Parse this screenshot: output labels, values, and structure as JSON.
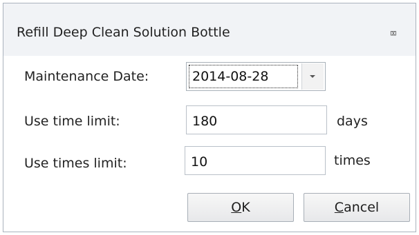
{
  "dialog": {
    "title": "Refill Deep Clean Solution Bottle",
    "close_glyph": "⌧"
  },
  "form": {
    "maintenance_date_label": "Maintenance Date:",
    "maintenance_date_value": "2014-08-28",
    "use_time_limit_label": "Use time limit:",
    "use_time_limit_value": "180",
    "use_time_limit_unit": "days",
    "use_times_limit_label": "Use times limit:",
    "use_times_limit_value": "10",
    "use_times_limit_unit": "times"
  },
  "buttons": {
    "ok_mnemonic": "O",
    "ok_rest": "K",
    "cancel_mnemonic": "C",
    "cancel_rest": "ancel"
  },
  "icons": {
    "close": "close-icon",
    "dropdown": "chevron-down-icon"
  }
}
